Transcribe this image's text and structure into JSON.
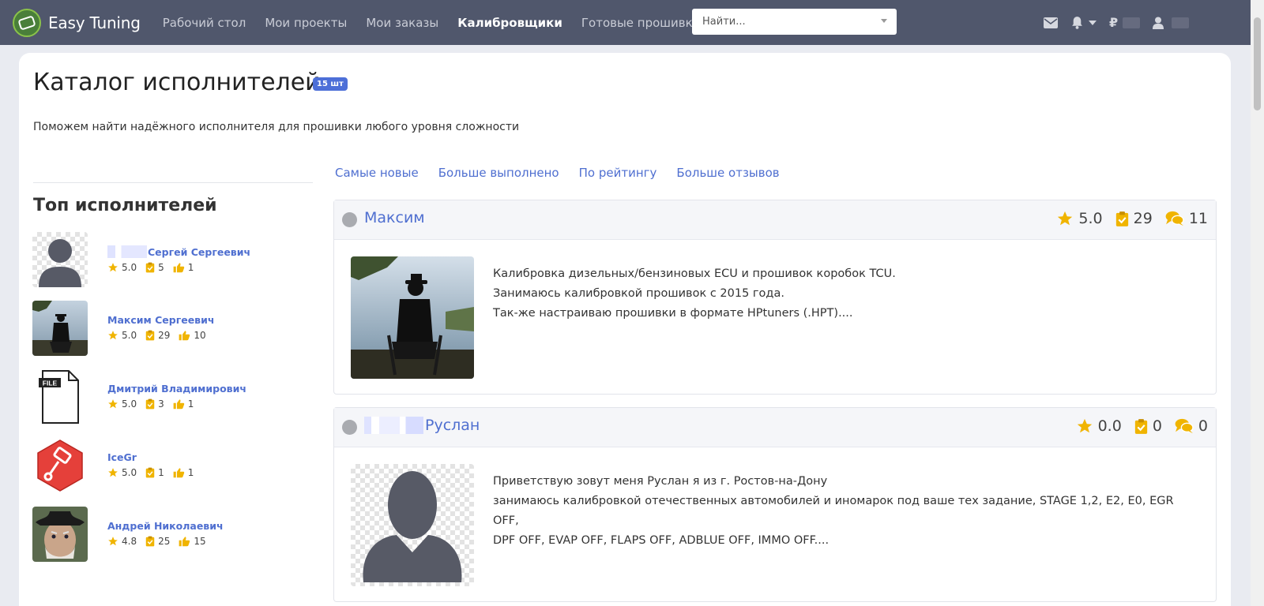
{
  "navbar": {
    "brand": "Easy Tuning",
    "links": [
      {
        "label": "Рабочий стол",
        "active": false
      },
      {
        "label": "Мои проекты",
        "active": false
      },
      {
        "label": "Мои заказы",
        "active": false
      },
      {
        "label": "Калибровщики",
        "active": true
      },
      {
        "label": "Готовые прошивки",
        "active": false
      }
    ],
    "search_placeholder": "Найти...",
    "currency": "₽"
  },
  "page": {
    "title": "Каталог исполнителей",
    "count_badge": "15 шт",
    "subtitle": "Поможем найти надёжного исполнителя для прошивки любого уровня сложности"
  },
  "top_performers": {
    "title": "Топ исполнителей",
    "items": [
      {
        "name": "Сергей Сергеевич",
        "rating": "5.0",
        "completed": "5",
        "likes": "1",
        "avatar": "silhouette",
        "blurred_prefix": true
      },
      {
        "name": "Максим Сергеевич",
        "rating": "5.0",
        "completed": "29",
        "likes": "10",
        "avatar": "photo-fisher",
        "blurred_prefix": false
      },
      {
        "name": "Дмитрий Владимирович",
        "rating": "5.0",
        "completed": "3",
        "likes": "1",
        "avatar": "file-icon",
        "blurred_prefix": false
      },
      {
        "name": "IceGr",
        "rating": "5.0",
        "completed": "1",
        "likes": "1",
        "avatar": "piston-hex",
        "blurred_prefix": false
      },
      {
        "name": "Андрей Николаевич",
        "rating": "4.8",
        "completed": "25",
        "likes": "15",
        "avatar": "photo-oldman",
        "blurred_prefix": false
      }
    ]
  },
  "sort_tabs": [
    "Самые новые",
    "Больше выполнено",
    "По рейтингу",
    "Больше отзывов"
  ],
  "performers": [
    {
      "name": "Максим",
      "rating": "5.0",
      "completed": "29",
      "reviews": "11",
      "avatar": "photo-fisher",
      "blurred_prefix": false,
      "description": [
        "Калибровка дизельных/бензиновых ECU и прошивок коробок TCU.",
        "Занимаюсь калибровкой прошивок с 2015 года.",
        "Так-же настраиваю прошивки в формате HPtuners (.HPT)...."
      ]
    },
    {
      "name": "Руслан",
      "rating": "0.0",
      "completed": "0",
      "reviews": "0",
      "avatar": "silhouette",
      "blurred_prefix": true,
      "description": [
        "Приветствую зовут меня Руслан я из г. Ростов-на-Дону",
        "занимаюсь калибровкой отечественных автомобилей и иномарок под ваше тех задание, STAGE 1,2, E2, E0, EGR OFF,",
        "DPF OFF, EVAP OFF, FLAPS OFF, ADBLUE OFF, IMMO OFF...."
      ]
    }
  ],
  "colors": {
    "navbar": "#50576c",
    "link": "#4f6fd0",
    "star": "#f0b400",
    "badge": "#4d6fd8"
  }
}
